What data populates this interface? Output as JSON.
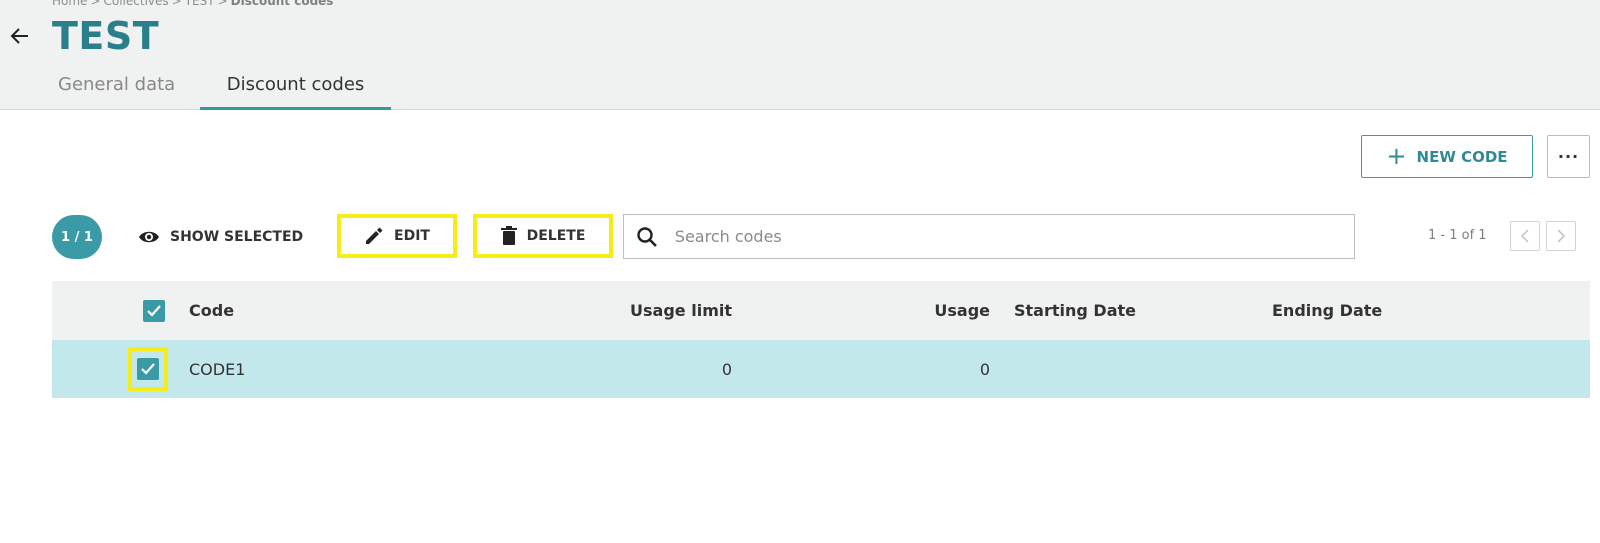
{
  "breadcrumb": {
    "items": [
      "Home",
      "Collectives",
      "TEST"
    ],
    "current": "Discount codes",
    "separator": ">"
  },
  "header": {
    "title": "TEST"
  },
  "tabs": [
    {
      "label": "General data",
      "active": false
    },
    {
      "label": "Discount codes",
      "active": true
    }
  ],
  "actions": {
    "new_code_label": "NEW CODE",
    "more_label": "···"
  },
  "toolbar": {
    "selected_count": "1 / 1",
    "show_selected_label": "SHOW SELECTED",
    "edit_label": "EDIT",
    "delete_label": "DELETE",
    "search_placeholder": "Search codes",
    "search_value": ""
  },
  "pagination": {
    "label": "1 - 1 of 1"
  },
  "table": {
    "columns": [
      "Code",
      "Usage limit",
      "Usage",
      "Starting Date",
      "Ending Date"
    ],
    "rows": [
      {
        "code": "CODE1",
        "usage_limit": "0",
        "usage": "0",
        "starting_date": "",
        "ending_date": "",
        "selected": true
      }
    ]
  },
  "colors": {
    "accent": "#3a9aa6",
    "title": "#2b7f8c",
    "highlight": "#f6ec17",
    "row_selected": "#c3e8ec"
  },
  "icons": [
    "arrow-left-icon",
    "plus-icon",
    "eye-icon",
    "pencil-icon",
    "trash-icon",
    "search-icon",
    "chevron-left-icon",
    "chevron-right-icon",
    "check-icon"
  ]
}
